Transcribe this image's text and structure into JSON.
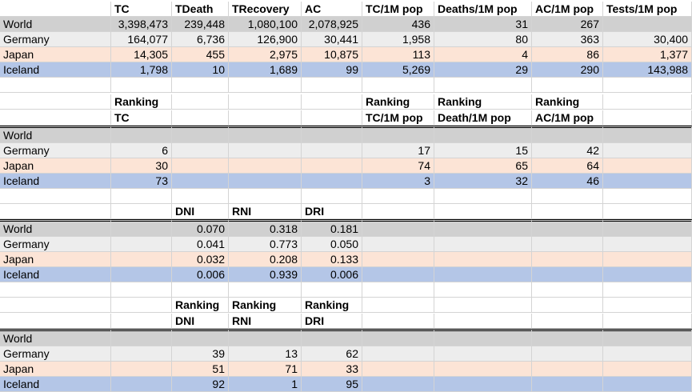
{
  "block1": {
    "headers": [
      "",
      "TC",
      "TDeath",
      "TRecovery",
      "AC",
      "TC/1M pop",
      "Deaths/1M pop",
      "AC/1M pop",
      "Tests/1M pop"
    ],
    "rows": [
      {
        "name": "World",
        "cells": [
          "3,398,473",
          "239,448",
          "1,080,100",
          "2,078,925",
          "436",
          "31",
          "267",
          ""
        ]
      },
      {
        "name": "Germany",
        "cells": [
          "164,077",
          "6,736",
          "126,900",
          "30,441",
          "1,958",
          "80",
          "363",
          "30,400"
        ]
      },
      {
        "name": "Japan",
        "cells": [
          "14,305",
          "455",
          "2,975",
          "10,875",
          "113",
          "4",
          "86",
          "1,377"
        ]
      },
      {
        "name": "Iceland",
        "cells": [
          "1,798",
          "10",
          "1,689",
          "99",
          "5,269",
          "29",
          "290",
          "143,988"
        ]
      }
    ]
  },
  "block2": {
    "header_line1": [
      "",
      "Ranking",
      "",
      "",
      "",
      "Ranking",
      "Ranking",
      "Ranking",
      ""
    ],
    "header_line2": [
      "",
      "TC",
      "",
      "",
      "",
      "TC/1M pop",
      "Death/1M pop",
      "AC/1M pop",
      ""
    ],
    "rows": [
      {
        "name": "World",
        "cells": [
          "",
          "",
          "",
          "",
          "",
          "",
          "",
          ""
        ]
      },
      {
        "name": "Germany",
        "cells": [
          "6",
          "",
          "",
          "",
          "17",
          "15",
          "42",
          ""
        ]
      },
      {
        "name": "Japan",
        "cells": [
          "30",
          "",
          "",
          "",
          "74",
          "65",
          "64",
          ""
        ]
      },
      {
        "name": "Iceland",
        "cells": [
          "73",
          "",
          "",
          "",
          "3",
          "32",
          "46",
          ""
        ]
      }
    ]
  },
  "block3": {
    "headers": [
      "",
      "",
      "DNI",
      "RNI",
      "DRI",
      "",
      "",
      "",
      ""
    ],
    "rows": [
      {
        "name": "World",
        "cells": [
          "",
          "0.070",
          "0.318",
          "0.181",
          "",
          "",
          "",
          ""
        ]
      },
      {
        "name": "Germany",
        "cells": [
          "",
          "0.041",
          "0.773",
          "0.050",
          "",
          "",
          "",
          ""
        ]
      },
      {
        "name": "Japan",
        "cells": [
          "",
          "0.032",
          "0.208",
          "0.133",
          "",
          "",
          "",
          ""
        ]
      },
      {
        "name": "Iceland",
        "cells": [
          "",
          "0.006",
          "0.939",
          "0.006",
          "",
          "",
          "",
          ""
        ]
      }
    ]
  },
  "block4": {
    "header_line1": [
      "",
      "",
      "Ranking",
      "Ranking",
      "Ranking",
      "",
      "",
      "",
      ""
    ],
    "header_line2": [
      "",
      "",
      "DNI",
      "RNI",
      "DRI",
      "",
      "",
      "",
      ""
    ],
    "rows": [
      {
        "name": "World",
        "cells": [
          "",
          "",
          "",
          "",
          "",
          "",
          "",
          ""
        ]
      },
      {
        "name": "Germany",
        "cells": [
          "",
          "39",
          "13",
          "62",
          "",
          "",
          "",
          ""
        ]
      },
      {
        "name": "Japan",
        "cells": [
          "",
          "51",
          "71",
          "33",
          "",
          "",
          "",
          ""
        ]
      },
      {
        "name": "Iceland",
        "cells": [
          "",
          "92",
          "1",
          "95",
          "",
          "",
          "",
          ""
        ]
      }
    ]
  }
}
